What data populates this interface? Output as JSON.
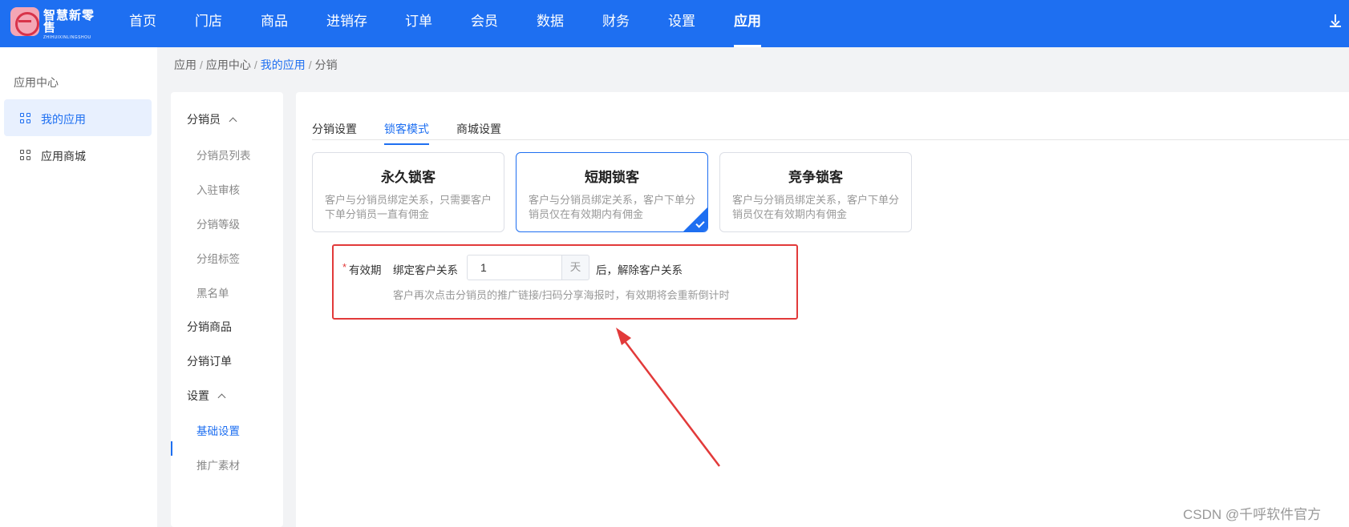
{
  "topbar": {
    "brand_cn": "智慧新零售",
    "brand_en": "ZHIHUIXINLINGSHOU",
    "nav": [
      "首页",
      "门店",
      "商品",
      "进销存",
      "订单",
      "会员",
      "数据",
      "财务",
      "设置",
      "应用"
    ],
    "active_nav": "应用",
    "accent": "#1e6ff1"
  },
  "sidebar": {
    "title": "应用中心",
    "items": [
      {
        "label": "我的应用",
        "icon": "grid-icon",
        "active": true
      },
      {
        "label": "应用商城",
        "icon": "grid-icon",
        "active": false
      }
    ]
  },
  "breadcrumb": [
    "应用",
    "应用中心",
    "我的应用",
    "分销"
  ],
  "submenu": {
    "distributor_group": "分销员",
    "distributor_items": [
      "分销员列表",
      "入驻审核",
      "分销等级",
      "分组标签",
      "黑名单"
    ],
    "products": "分销商品",
    "orders": "分销订单",
    "settings_group": "设置",
    "settings_items": [
      "基础设置",
      "推广素材"
    ],
    "active_item": "基础设置"
  },
  "tabs": [
    "分销设置",
    "锁客模式",
    "商城设置"
  ],
  "active_tab": "锁客模式",
  "lock_modes": [
    {
      "title": "永久锁客",
      "desc": "客户与分销员绑定关系，只需要客户下单分销员一直有佣金",
      "selected": false
    },
    {
      "title": "短期锁客",
      "desc": "客户与分销员绑定关系，客户下单分销员仅在有效期内有佣金",
      "selected": true
    },
    {
      "title": "竞争锁客",
      "desc": "客户与分销员绑定关系，客户下单分销员仅在有效期内有佣金",
      "selected": false
    }
  ],
  "validity": {
    "required_mark": "*",
    "label": "有效期",
    "prefix": "绑定客户关系",
    "value": "1",
    "unit": "天",
    "suffix": "后，解除客户关系",
    "hint": "客户再次点击分销员的推广链接/扫码分享海报时，有效期将会重新倒计时"
  },
  "watermark": "CSDN @千呼软件官方"
}
